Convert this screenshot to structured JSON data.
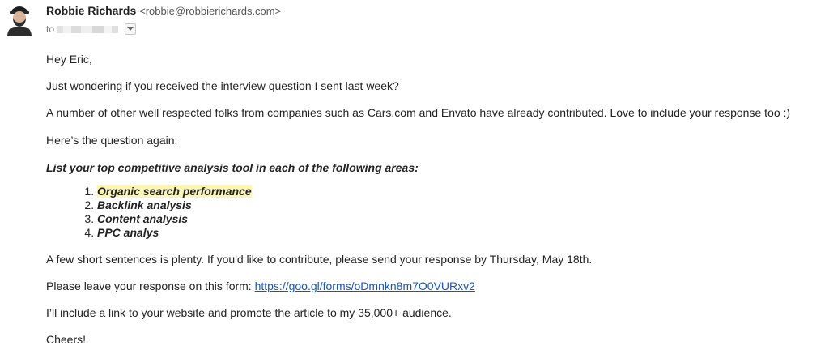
{
  "email": {
    "sender": {
      "name": "Robbie Richards",
      "address": "<robbie@robbierichards.com>"
    },
    "to_label": "to",
    "greeting": "Hey Eric,",
    "line1": "Just wondering if you received the interview question I sent last week?",
    "line2": "A number of other well respected folks from companies such as Cars.com and Envato have already contributed. Love to include your response too :)",
    "line3": "Here’s the question again:",
    "question": {
      "part1": "List your top competitive analysis tool in ",
      "emphasis": "each",
      "part2": " of the following areas:"
    },
    "areas": [
      "Organic search performance",
      "Backlink analysis",
      "Content analysis",
      "PPC analys"
    ],
    "line5": "A few short sentences is plenty. If you'd like to contribute, please send your response by Thursday, May 18th.",
    "line6": {
      "text": "Please leave your response on this form: ",
      "link": "https://goo.gl/forms/oDmnkn8m7O0VURxv2"
    },
    "line7": "I’ll include a link to your website and promote the article to my 35,000+ audience.",
    "signoff": "Cheers!",
    "colors": {
      "link": "#1155cc",
      "highlight": "#fcf6b6",
      "text": "#222222"
    },
    "icons": {
      "avatar": "sender-avatar",
      "dropdown": "chevron-down-icon"
    }
  }
}
